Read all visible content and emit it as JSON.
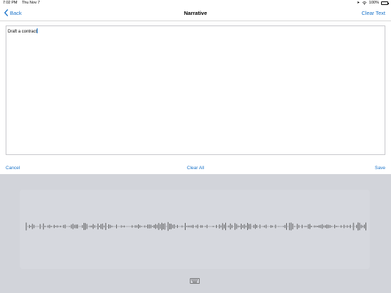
{
  "status_bar": {
    "time": "7:02 PM",
    "date": "Thu Nov 7",
    "battery": "100%",
    "icons": [
      "location-arrow-icon",
      "wifi-icon",
      "battery-icon"
    ]
  },
  "nav": {
    "back_label": "Back",
    "title": "Narrative",
    "clear_text_label": "Clear Text"
  },
  "editor": {
    "text": "Draft a contract"
  },
  "actions": {
    "cancel_label": "Cancel",
    "clear_all_label": "Clear All",
    "save_label": "Save"
  },
  "dictation": {
    "icons": [
      "waveform-icon",
      "keyboard-icon"
    ]
  },
  "colors": {
    "accent": "#1a73c9",
    "panel": "#d2d4da",
    "waveform": "#3c3c3c"
  }
}
